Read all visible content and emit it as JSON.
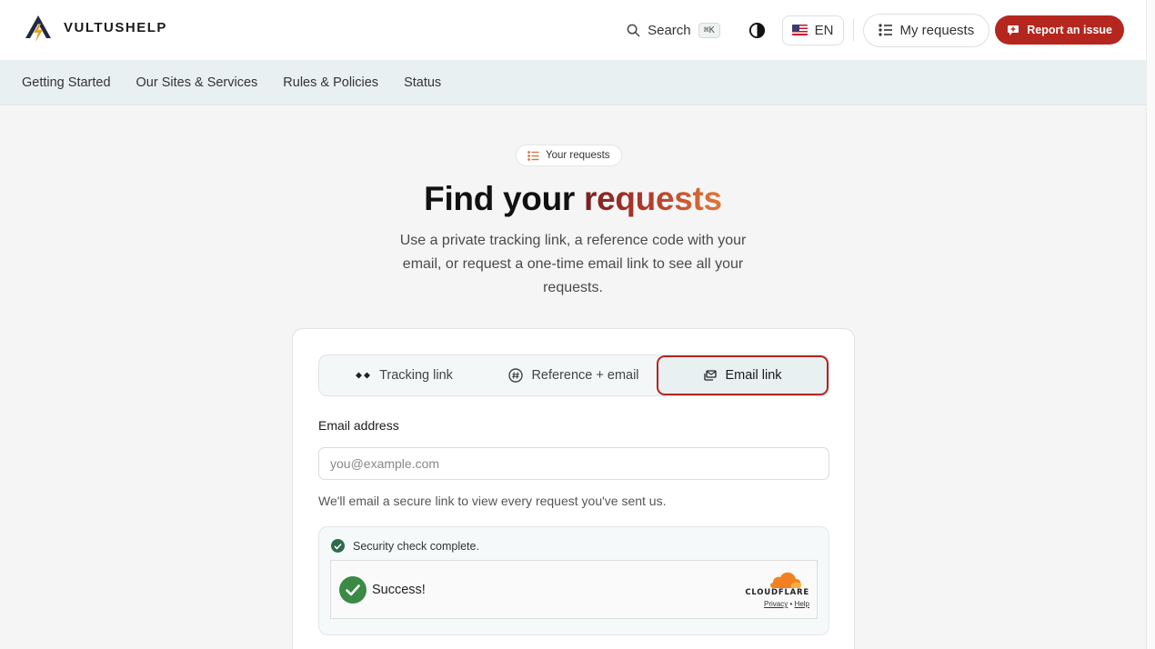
{
  "brand": {
    "name": "VULTUSHELP",
    "logo_icon": "mountain-bolt-logo"
  },
  "header": {
    "search_label": "Search",
    "search_shortcut": "⌘K",
    "theme_icon": "contrast-icon",
    "language": "EN",
    "my_requests_label": "My requests",
    "report_label": "Report an issue"
  },
  "nav": {
    "items": [
      {
        "label": "Getting Started"
      },
      {
        "label": "Our Sites & Services"
      },
      {
        "label": "Rules & Policies"
      },
      {
        "label": "Status"
      }
    ]
  },
  "hero": {
    "pill_label": "Your requests",
    "title_main": "Find your ",
    "title_accent": "requests",
    "subtitle": "Use a private tracking link, a reference code with your email, or request a one-time email link to see all your requests."
  },
  "form": {
    "tabs": [
      {
        "label": "Tracking link",
        "icon": "link-dots-icon"
      },
      {
        "label": "Reference + email",
        "icon": "hash-icon"
      },
      {
        "label": "Email link",
        "icon": "mail-stack-icon",
        "active": true
      }
    ],
    "email_label": "Email address",
    "email_placeholder": "you@example.com",
    "email_value": "",
    "hint": "We'll email a secure link to view every request you've sent us."
  },
  "security": {
    "status": "Security check complete.",
    "success_text": "Success!",
    "provider": "CLOUDFLARE",
    "privacy_link": "Privacy",
    "link_separator": "•",
    "help_link": "Help"
  },
  "colors": {
    "accent_red": "#b5261e",
    "subnav_bg": "#e9f0f1",
    "success_green": "#3a8a45",
    "cloudflare_orange": "#f38020"
  }
}
